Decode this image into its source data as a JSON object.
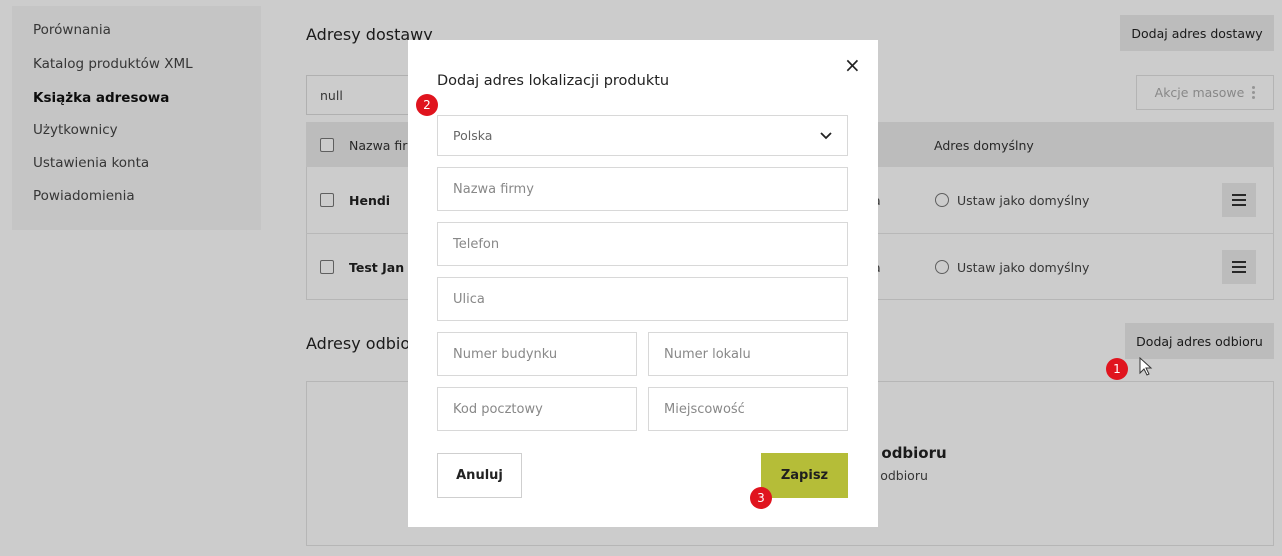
{
  "sidebar": {
    "items": [
      {
        "label": "Porównania"
      },
      {
        "label": "Katalog produktów XML"
      },
      {
        "label": "Książka adresowa"
      },
      {
        "label": "Użytkownicy"
      },
      {
        "label": "Ustawienia konta"
      },
      {
        "label": "Powiadomienia"
      }
    ]
  },
  "delivery": {
    "title": "Adresy dostawy",
    "add_button": "Dodaj adres dostawy",
    "search_value": "null",
    "mass_actions": "Akcje masowe",
    "columns": [
      "Nazwa firm",
      "Adres domyślny"
    ],
    "rows": [
      {
        "name": "Hendi",
        "col_fragment": "ka",
        "default_label": "Ustaw jako domyślny"
      },
      {
        "name": "Test Jan k",
        "col_fragment": "ka",
        "default_label": "Ustaw jako domyślny"
      }
    ]
  },
  "pickup": {
    "title": "Adresy odbio",
    "add_button": "Dodaj adres odbioru",
    "empty_title": "ów odbioru",
    "empty_subtitle": "w odbioru"
  },
  "modal": {
    "title": "Dodaj adres lokalizacji produktu",
    "close_icon": "×",
    "country": "Polska",
    "fields": {
      "company": "Nazwa firmy",
      "phone": "Telefon",
      "street": "Ulica",
      "building": "Numer budynku",
      "unit": "Numer lokalu",
      "postal": "Kod pocztowy",
      "city": "Miejscowość"
    },
    "cancel": "Anuluj",
    "save": "Zapisz"
  },
  "annotations": [
    "1",
    "2",
    "3"
  ],
  "colors": {
    "accent": "#b5bd38",
    "badge": "#e0141e",
    "overlay": "rgba(0,0,0,0.2)"
  },
  "icons": [
    "chevron-down-icon",
    "close-icon",
    "hamburger-icon",
    "kebab-icon",
    "cursor-arrow-icon"
  ]
}
